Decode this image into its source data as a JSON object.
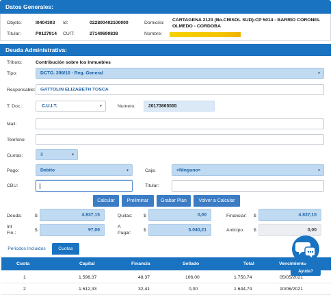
{
  "general": {
    "header": "Datos Generales:",
    "objeto_label": "Objeto:",
    "objeto_value": "I0404303",
    "id_label": "Id:",
    "id_value": "022800402100000",
    "domicilio_label": "Domicilio:",
    "domicilio_value_1": "CARTAGENA 2123 (Bo.CRISOL SUD)-CP 5014 - BARRIO CORONEL",
    "domicilio_value_2": "OLMEDO - CORDOBA",
    "titular_label": "Titular:",
    "titular_value": "P0127914",
    "cuit_label": "CUIT:",
    "cuit_value": "27149690838",
    "nombre_label": "Nombre:"
  },
  "deuda": {
    "header": "Deuda Administrativa:",
    "tributo_label": "Tributo:",
    "tributo_value": "Contribución sobre los Inmuebles",
    "tipo_label": "Tipo:",
    "tipo_value": "DCTO. 398/16 - Reg. General",
    "responsable_label": "Responsable:",
    "responsable_value": "GATTOLIN ELIZABETH TOSCA",
    "tdoc_label": "T. Doc.:",
    "tdoc_value": "C.U.I.T.",
    "numero_label": "Numero:",
    "numero_value": "20173865555",
    "mail_label": "Mail:",
    "telefono_label": "Telefono:",
    "cuotas_label": "Cuotas:",
    "cuotas_value": "3",
    "pago_label": "Pago:",
    "pago_value": "Debito",
    "caja_label": "Caja:",
    "caja_value": "<Ninguno>",
    "cbu_label": "CBU:",
    "titular_label": "Titular:"
  },
  "buttons": {
    "calcular": "Calcular",
    "preliminar": "Preliminar",
    "grabar": "Grabar Plan",
    "volver": "Volver a Calcular"
  },
  "totals": {
    "currency": "$",
    "deuda_label": "Deuda:",
    "deuda_value": "4.837,15",
    "quitas_label": "Quitas:",
    "quitas_value": "0,00",
    "financiar_label": "Financiar:",
    "financiar_value": "4.837,15",
    "intfin_label_1": "Int",
    "intfin_label_2": "Fin.:",
    "intfin_value": "97,06",
    "apagar_label_1": "A",
    "apagar_label_2": "Pagar:",
    "apagar_value": "5.040,21",
    "anticipo_label": "Anticipo:",
    "anticipo_value": "0,00"
  },
  "tabs": {
    "periodos": "Periodos Incluidos",
    "cuotas": "Cuotas"
  },
  "table": {
    "headers": [
      "Cuota",
      "Capital",
      "Financia",
      "Sellado",
      "Total",
      "Vencimiento"
    ],
    "rows": [
      [
        "1",
        "1.596,37",
        "48,37",
        "106,00",
        "1.750,74",
        "05/05/2021"
      ],
      [
        "2",
        "1.612,33",
        "32,41",
        "0,00",
        "1.644,74",
        "10/06/2021"
      ]
    ]
  },
  "help": {
    "label": "Ayuda?"
  },
  "colors": {
    "header_blue": "#1a73c1",
    "field_blue": "#bfdaf1",
    "button_blue": "#3b7cc4",
    "highlight_yellow": "#f5d100"
  }
}
